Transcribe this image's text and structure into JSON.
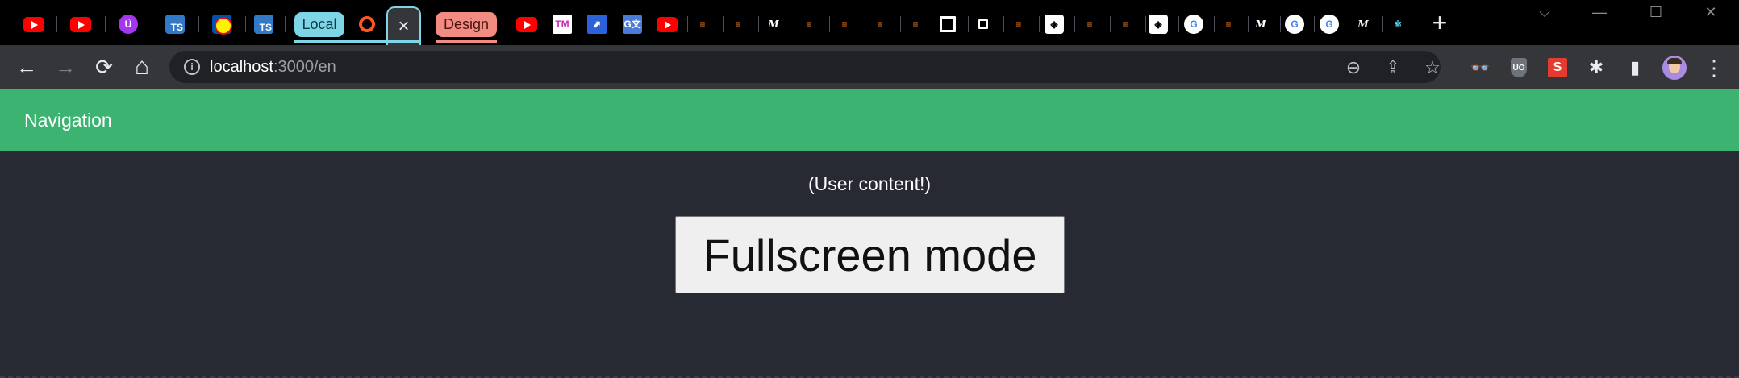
{
  "browser": {
    "tab_groups": {
      "local_label": "Local",
      "design_label": "Design"
    },
    "active_tab_close": "×",
    "new_tab": "+",
    "window_controls": {
      "collapse": "⌵",
      "minimize": "—",
      "maximize": "☐",
      "close": "✕"
    },
    "tab_favicons": [
      "youtube",
      "youtube",
      "udemy",
      "typescript",
      "lidl",
      "typescript",
      "brave-like",
      "youtube",
      "tm",
      "extension",
      "google-translate",
      "youtube",
      "stackoverflow",
      "stackoverflow",
      "medium",
      "stackoverflow",
      "stackoverflow",
      "stackoverflow",
      "stackoverflow",
      "square",
      "square-small",
      "stackoverflow",
      "codepen",
      "stackoverflow",
      "stackoverflow",
      "codepen",
      "google",
      "stackoverflow",
      "medium",
      "google",
      "google",
      "medium",
      "react"
    ],
    "nav": {
      "back": "←",
      "forward": "→",
      "reload": "⟳",
      "home": "⌂"
    },
    "omnibox": {
      "info": "i",
      "host": "localhost",
      "rest": ":3000/en",
      "zoom": "⊖",
      "share": "⇪",
      "bookmark": "☆"
    },
    "extensions": {
      "s_label": "S",
      "ublock_label": "UO",
      "puzzle": "✱",
      "sidepanel": "▮",
      "menu": "⋮"
    }
  },
  "page": {
    "nav_title": "Navigation",
    "user_content": "(User content!)",
    "fullscreen_button": "Fullscreen mode"
  }
}
